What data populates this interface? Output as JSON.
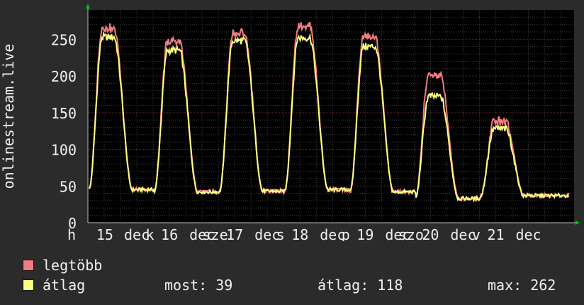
{
  "colors": {
    "background": "#2b2b2b",
    "plot_background": "#000000",
    "grid_major": "#5a2a2a",
    "grid_minor": "#3a3a3a",
    "axis": "#bbbbbb",
    "arrow": "#00cc00",
    "text": "#f0f0f0"
  },
  "chart_data": {
    "type": "line",
    "ylabel": "onlinestream.live",
    "ylim": [
      0,
      290
    ],
    "yticks": [
      0,
      50,
      100,
      150,
      200,
      250
    ],
    "xlim": [
      0,
      7.45
    ],
    "xtick_labels": [
      {
        "x": -0.25,
        "label": "h"
      },
      {
        "x": 0.26,
        "label": "15"
      },
      {
        "x": 0.75,
        "label": "dec"
      },
      {
        "x": 0.95,
        "label": "k"
      },
      {
        "x": 1.25,
        "label": "16"
      },
      {
        "x": 1.75,
        "label": "dec"
      },
      {
        "x": 1.95,
        "label": "sze"
      },
      {
        "x": 2.25,
        "label": "17"
      },
      {
        "x": 2.75,
        "label": "dec"
      },
      {
        "x": 2.95,
        "label": "s"
      },
      {
        "x": 3.25,
        "label": "18"
      },
      {
        "x": 3.75,
        "label": "dec"
      },
      {
        "x": 3.95,
        "label": "p"
      },
      {
        "x": 4.25,
        "label": "19"
      },
      {
        "x": 4.75,
        "label": "dec"
      },
      {
        "x": 4.95,
        "label": "szo"
      },
      {
        "x": 5.25,
        "label": "20"
      },
      {
        "x": 5.75,
        "label": "dec"
      },
      {
        "x": 5.95,
        "label": "v"
      },
      {
        "x": 6.25,
        "label": "21"
      },
      {
        "x": 6.75,
        "label": "dec"
      }
    ],
    "peaks_max": [
      262,
      245,
      255,
      265,
      250,
      198,
      135
    ],
    "peaks_avg": [
      253,
      235,
      248,
      252,
      240,
      172,
      128
    ],
    "troughs": [
      45,
      42,
      43,
      45,
      42,
      33,
      37
    ],
    "series": [
      {
        "name": "legtöbb",
        "color": "#f07c82"
      },
      {
        "name": "átlag",
        "color": "#ffff80"
      }
    ],
    "stats": {
      "most": "39",
      "atlag": "118",
      "max": "262"
    }
  },
  "legend": {
    "max_label": "legtöbb",
    "avg_label": "átlag",
    "now_text": "most: 39",
    "avg_text": "átlag: 118",
    "max_text": "max: 262"
  }
}
